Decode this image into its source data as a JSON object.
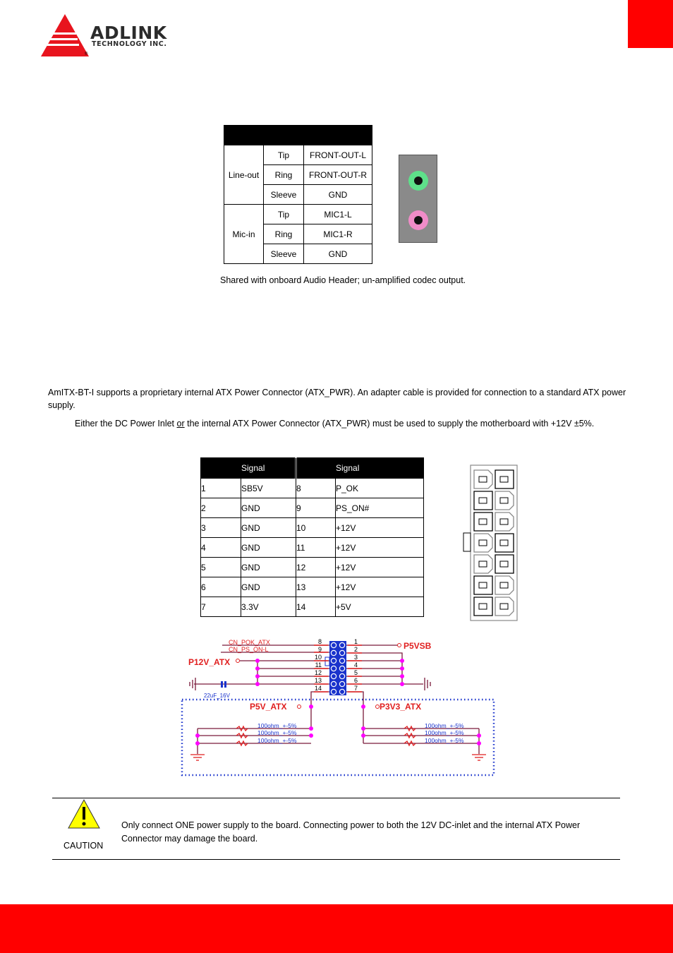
{
  "header": {
    "brand": "ADLINK",
    "brand_sub": "TECHNOLOGY INC.",
    "registered_mark": "®",
    "accent_color": "#ff0000"
  },
  "audio_table": {
    "header": [
      "",
      "",
      ""
    ],
    "groups": [
      {
        "name": "Line-out",
        "rows": [
          {
            "pin": "Tip",
            "signal": "FRONT-OUT-L"
          },
          {
            "pin": "Ring",
            "signal": "FRONT-OUT-R"
          },
          {
            "pin": "Sleeve",
            "signal": "GND"
          }
        ]
      },
      {
        "name": "Mic-in",
        "rows": [
          {
            "pin": "Tip",
            "signal": "MIC1-L"
          },
          {
            "pin": "Ring",
            "signal": "MIC1-R"
          },
          {
            "pin": "Sleeve",
            "signal": "GND"
          }
        ]
      }
    ],
    "jack_colors": {
      "line_out": "#5ee08a",
      "mic_in": "#f08cc8"
    }
  },
  "audio_caption": "Shared with onboard Audio Header; un-amplified codec output.",
  "atx_section": {
    "intro": "AmITX-BT-I supports a proprietary internal ATX Power Connector (ATX_PWR). An adapter cable is provided for connection to a standard ATX power supply.",
    "note_before": "Either the DC Power Inlet ",
    "note_underlined": "or",
    "note_after": " the internal ATX Power Connector (ATX_PWR) must be used to supply the motherboard with +12V ±5%."
  },
  "atx_table": {
    "headers": [
      "",
      "Signal",
      "",
      "Signal"
    ],
    "rows": [
      [
        "1",
        "SB5V",
        "8",
        "P_OK"
      ],
      [
        "2",
        "GND",
        "9",
        "PS_ON#"
      ],
      [
        "3",
        "GND",
        "10",
        "+12V"
      ],
      [
        "4",
        "GND",
        "11",
        "+12V"
      ],
      [
        "5",
        "GND",
        "12",
        "+12V"
      ],
      [
        "6",
        "GND",
        "13",
        "+12V"
      ],
      [
        "7",
        "3.3V",
        "14",
        "+5V"
      ]
    ]
  },
  "schematic": {
    "left_pins": [
      "8",
      "9",
      "10",
      "11",
      "12",
      "13",
      "14"
    ],
    "right_pins": [
      "1",
      "2",
      "3",
      "4",
      "5",
      "6",
      "7"
    ],
    "net_pok": "CN_POK_ATX",
    "net_pson": "CN_PS_ON-L",
    "p12v": "P12V_ATX",
    "p5vsb": "P5VSB",
    "p5v": "P5V_ATX",
    "p3v3": "P3V3_ATX",
    "cap_label": "22uF_16V",
    "resistor_label": "100ohm_+-5%"
  },
  "caution": {
    "label": "CAUTION",
    "text": "Only connect ONE power supply to the board. Connecting power to both the 12V DC-inlet and the internal ATX Power Connector  may damage the board."
  }
}
